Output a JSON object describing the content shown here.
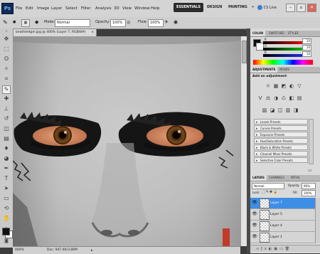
{
  "app": {
    "logo": "Ps"
  },
  "menu": [
    "File",
    "Edit",
    "Image",
    "Layer",
    "Select",
    "Filter",
    "Analysis",
    "3D",
    "View",
    "Window",
    "Help"
  ],
  "workspaces": {
    "active": "ESSENTIALS",
    "others": [
      "DESIGN",
      "PAINTING"
    ],
    "more": "»"
  },
  "cs_live": "CS Live",
  "window_controls": [
    "–",
    "▫",
    "✕"
  ],
  "options_bar": {
    "mode_label": "Mode:",
    "mode_value": "Normal",
    "opacity_label": "Opacity:",
    "opacity_value": "100%",
    "flow_label": "Flow:",
    "flow_value": "100%"
  },
  "document": {
    "tab_title": "beathtedger.jpg @ 400% (Layer 7, RGB/8#)"
  },
  "status": {
    "zoom": "400%",
    "doc": "Doc: 947.4K/3.86M"
  },
  "color_panel": {
    "tabs": [
      "COLOR",
      "SWATCHES",
      "STYLES"
    ],
    "channels": [
      {
        "label": "R",
        "value": "10"
      },
      {
        "label": "G",
        "value": "10"
      },
      {
        "label": "B",
        "value": "10"
      }
    ]
  },
  "adjustments_panel": {
    "tabs": [
      "ADJUSTMENTS",
      "MASKS"
    ],
    "heading": "Add an adjustment",
    "icon_rows": [
      [
        "☼",
        "▦",
        "◩",
        "◐",
        "▽"
      ],
      [
        "V",
        "⚖",
        "◑",
        "♺",
        "◧",
        "▤"
      ],
      [
        "▨",
        "◪",
        "◫",
        "▥",
        "◨"
      ]
    ],
    "presets": [
      "Levels Presets",
      "Curves Presets",
      "Exposure Presets",
      "Hue/Saturation Presets",
      "Black & White Presets",
      "Channel Mixer Presets",
      "Selective Color Presets"
    ]
  },
  "layers_panel": {
    "tabs": [
      "LAYERS",
      "CHANNELS",
      "PATHS"
    ],
    "blend_mode": "Normal",
    "opacity_label": "Opacity:",
    "opacity_value": "96%",
    "lock_label": "Lock:",
    "fill_label": "Fill:",
    "fill_value": "100%",
    "layers": [
      {
        "name": "Layer 7",
        "selected": true
      },
      {
        "name": "Layer 5",
        "selected": false
      },
      {
        "name": "Layer 4",
        "selected": false
      },
      {
        "name": "Layer 1",
        "selected": false
      }
    ]
  },
  "colors": {
    "accent": "#3e8ee6",
    "workspace_active": "#2b2b2b",
    "foreground": "#111111",
    "background": "#ffffff"
  }
}
